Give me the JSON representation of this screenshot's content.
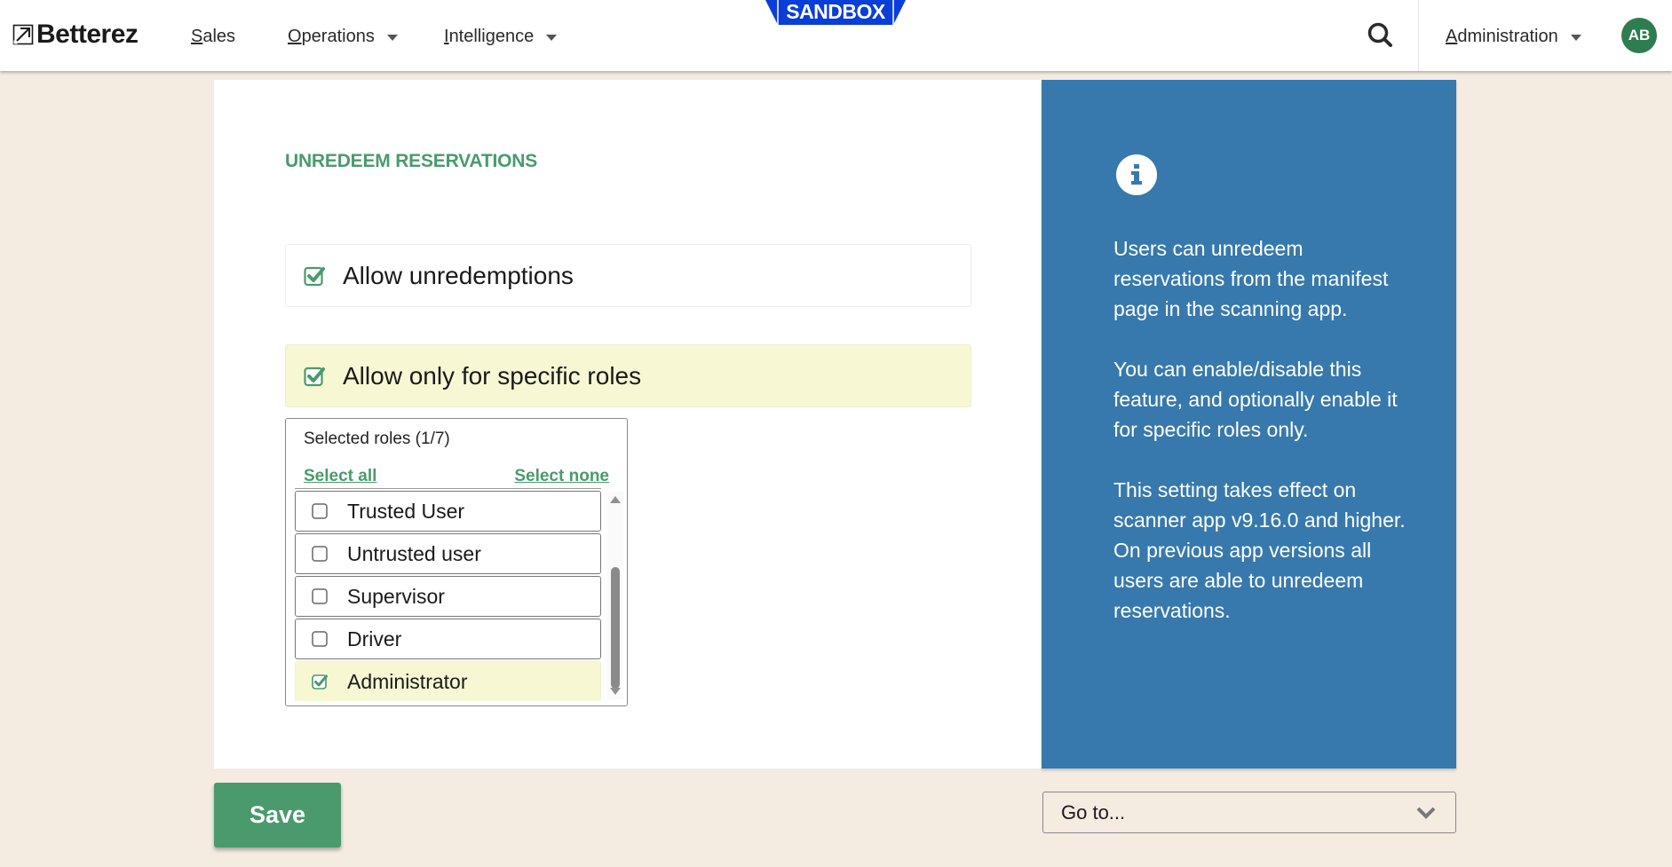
{
  "header": {
    "logo_text": "Betterez",
    "nav": [
      {
        "label": "Sales",
        "mnemonic": "S",
        "rest": "ales",
        "has_dropdown": false
      },
      {
        "label": "Operations",
        "mnemonic": "O",
        "rest": "perations",
        "has_dropdown": true
      },
      {
        "label": "Intelligence",
        "mnemonic": "I",
        "rest": "ntelligence",
        "has_dropdown": true
      }
    ],
    "environment_badge": "SANDBOX",
    "search_icon": "search-icon",
    "admin_menu": {
      "label": "Administration",
      "mnemonic": "A",
      "rest": "dministration",
      "has_dropdown": true
    },
    "avatar_initials": "AB"
  },
  "main": {
    "section_title": "UNREDEEM RESERVATIONS",
    "options": [
      {
        "label": "Allow unredemptions",
        "checked": true
      },
      {
        "label": "Allow only for specific roles",
        "checked": true
      }
    ],
    "roles": {
      "header": "Selected roles (1/7)",
      "select_all": "Select all",
      "select_none": "Select none",
      "items": [
        {
          "label": "Trusted User",
          "checked": false
        },
        {
          "label": "Untrusted user",
          "checked": false
        },
        {
          "label": "Supervisor",
          "checked": false
        },
        {
          "label": "Driver",
          "checked": false
        },
        {
          "label": "Administrator",
          "checked": true
        }
      ]
    }
  },
  "info": {
    "icon": "info-icon",
    "paragraphs": [
      "Users can unredeem reservations from the manifest page in the scanning app.",
      "You can enable/disable this feature, and optionally enable it for specific roles only.",
      "This setting takes effect on scanner app v9.16.0 and higher. On previous app versions all users are able to unredeem reservations."
    ]
  },
  "footer": {
    "save_label": "Save",
    "goto_placeholder": "Go to..."
  },
  "colors": {
    "brand_green": "#4a9a6d",
    "info_blue": "#3779ad",
    "highlight_yellow": "#f7f8d3",
    "sandbox_blue": "#0a3ed6",
    "avatar_green": "#2e7d4f",
    "page_bg": "#f4ebe1"
  }
}
